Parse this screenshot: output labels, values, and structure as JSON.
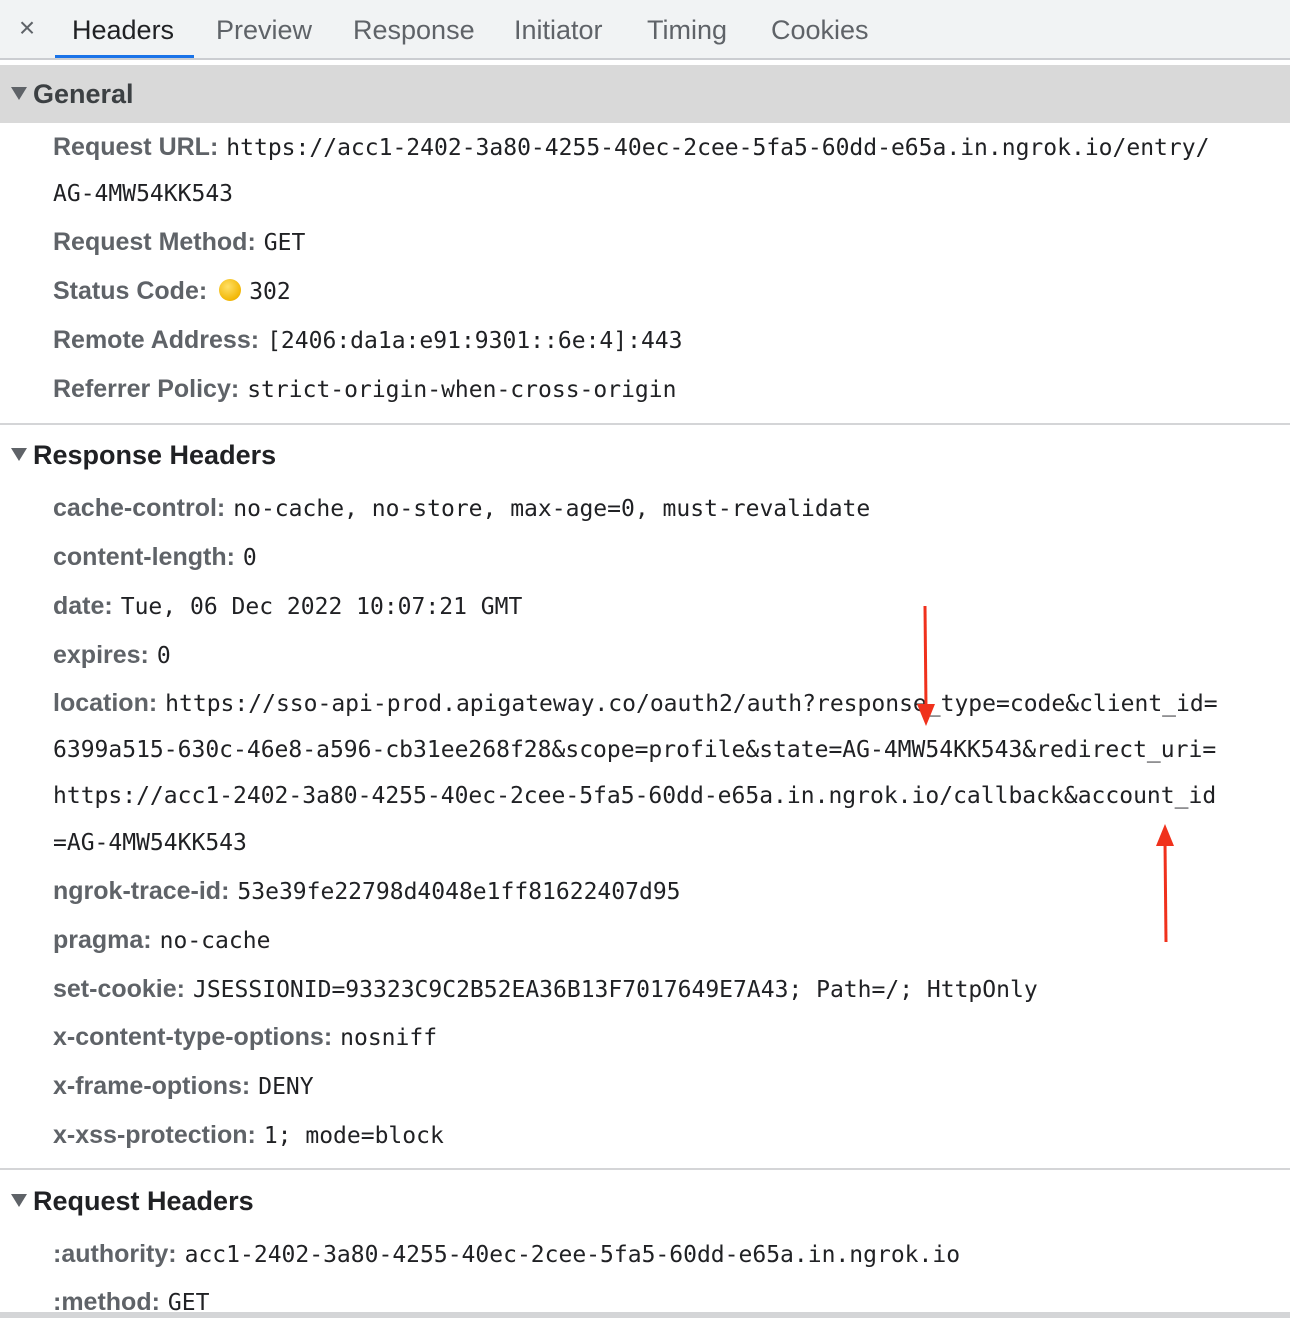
{
  "tabs": {
    "close_glyph": "×",
    "items": [
      {
        "label": "Headers"
      },
      {
        "label": "Preview"
      },
      {
        "label": "Response"
      },
      {
        "label": "Initiator"
      },
      {
        "label": "Timing"
      },
      {
        "label": "Cookies"
      }
    ],
    "active_index": 0,
    "accent_color": "#1a73e8"
  },
  "general": {
    "title": "General",
    "request_url_key": "Request URL:",
    "request_url_line1": "https://acc1-2402-3a80-4255-40ec-2cee-5fa5-60dd-e65a.in.ngrok.io/entry/",
    "request_url_line2": "AG-4MW54KK543",
    "method_key": "Request Method:",
    "method_val": "GET",
    "status_key": "Status Code:",
    "status_val": "302",
    "status_color": "#f2b705",
    "remote_key": "Remote Address:",
    "remote_val": "[2406:da1a:e91:9301::6e:4]:443",
    "referrer_key": "Referrer Policy:",
    "referrer_val": "strict-origin-when-cross-origin"
  },
  "response_headers": {
    "title": "Response Headers",
    "cache_control_key": "cache-control:",
    "cache_control_val": "no-cache, no-store, max-age=0, must-revalidate",
    "content_length_key": "content-length:",
    "content_length_val": "0",
    "date_key": "date:",
    "date_val": "Tue, 06 Dec 2022 10:07:21 GMT",
    "expires_key": "expires:",
    "expires_val": "0",
    "location_key": "location:",
    "location_line1": "https://sso-api-prod.apigateway.co/oauth2/auth?response_type=code&client_id=",
    "location_line2": "6399a515-630c-46e8-a596-cb31ee268f28&scope=profile&state=AG-4MW54KK543&redirect_uri=",
    "location_line3": "https://acc1-2402-3a80-4255-40ec-2cee-5fa5-60dd-e65a.in.ngrok.io/callback&account_id",
    "location_line4": "=AG-4MW54KK543",
    "trace_key": "ngrok-trace-id:",
    "trace_val": "53e39fe22798d4048e1ff81622407d95",
    "pragma_key": "pragma:",
    "pragma_val": "no-cache",
    "setcookie_key": "set-cookie:",
    "setcookie_val": "JSESSIONID=93323C9C2B52EA36B13F7017649E7A43; Path=/; HttpOnly",
    "xcto_key": "x-content-type-options:",
    "xcto_val": "nosniff",
    "xfo_key": "x-frame-options:",
    "xfo_val": "DENY",
    "xxss_key": "x-xss-protection:",
    "xxss_val": "1; mode=block"
  },
  "request_headers": {
    "title": "Request Headers",
    "authority_key": ":authority:",
    "authority_val": "acc1-2402-3a80-4255-40ec-2cee-5fa5-60dd-e65a.in.ngrok.io",
    "method_key": ":method:",
    "method_val": "GET"
  },
  "annotation_color": "#f0311c"
}
